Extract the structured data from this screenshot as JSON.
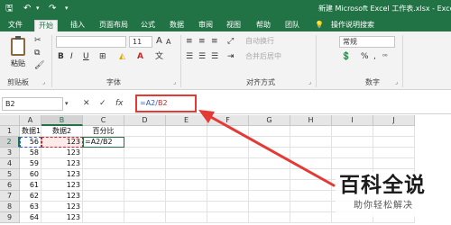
{
  "window": {
    "title": "新建 Microsoft Excel 工作表.xlsx - Excel"
  },
  "ribbon_tabs": [
    "文件",
    "开始",
    "插入",
    "页面布局",
    "公式",
    "数据",
    "审阅",
    "视图",
    "帮助",
    "团队",
    "操作说明搜索"
  ],
  "ribbon": {
    "paste_label": "粘贴",
    "groups": [
      "剪贴板",
      "字体",
      "对齐方式",
      "数字"
    ],
    "font_size": "11",
    "font_grow": "A",
    "font_shrink": "A",
    "format_wenzi": "文",
    "merge_label": "合并后居中",
    "wrap_label": "自动换行",
    "number_format": "常规",
    "bold": "B",
    "italic": "I",
    "underline": "U"
  },
  "formula_bar": {
    "name_box": "B2",
    "cancel": "✕",
    "enter": "✓",
    "fx": "fx",
    "formula_prefix": "=A2/",
    "formula_ref": "B2"
  },
  "sheet": {
    "columns": [
      "A",
      "B",
      "C",
      "D",
      "E",
      "F",
      "G",
      "H",
      "I",
      "J"
    ],
    "rows": [
      "1",
      "2",
      "3",
      "4",
      "5",
      "6",
      "7",
      "8",
      "9"
    ],
    "cells": [
      [
        "数据1",
        "数据2",
        "百分比"
      ],
      [
        "56",
        "123",
        "=A2/B2"
      ],
      [
        "58",
        "123",
        ""
      ],
      [
        "59",
        "123",
        ""
      ],
      [
        "60",
        "123",
        ""
      ],
      [
        "61",
        "123",
        ""
      ],
      [
        "62",
        "123",
        ""
      ],
      [
        "63",
        "123",
        ""
      ],
      [
        "64",
        "123",
        ""
      ]
    ]
  },
  "watermark": {
    "brand": "百科全说",
    "slogan": "助你轻松解决"
  },
  "colors": {
    "excel_green": "#217346",
    "annotation_red": "#e53935",
    "ref_blue": "#2a58c9",
    "ref_red": "#c62828"
  }
}
